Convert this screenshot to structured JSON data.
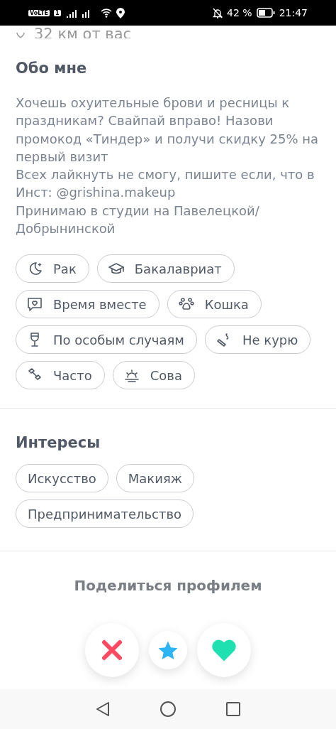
{
  "status_bar": {
    "network": "VoLTE",
    "sim": "1",
    "battery": "42 %",
    "time": "21:47"
  },
  "distance": "32 км от вас",
  "about": {
    "title": "Обо мне",
    "paragraphs": [
      "Хочешь охуительные брови и ресницы к праздникам? Свайпай вправо! Назови промокод «Тиндер» и получи скидку 25% на первый визит",
      "Всех лайкнуть не смогу, пишите если, что в Инст: @grishina.makeup",
      "Принимаю в студии на Павелецкой/ Добрынинской"
    ]
  },
  "chips": [
    {
      "label": "Рак"
    },
    {
      "label": "Бакалавриат"
    },
    {
      "label": "Время вместе"
    },
    {
      "label": "Кошка"
    },
    {
      "label": "По особым случаям"
    },
    {
      "label": "Не курю"
    },
    {
      "label": "Часто"
    },
    {
      "label": "Сова"
    }
  ],
  "interests": {
    "title": "Интересы",
    "items": [
      {
        "label": "Искусство"
      },
      {
        "label": "Макияж"
      },
      {
        "label": "Предпринимательство"
      }
    ]
  },
  "share": {
    "title": "Поделиться профилем"
  }
}
